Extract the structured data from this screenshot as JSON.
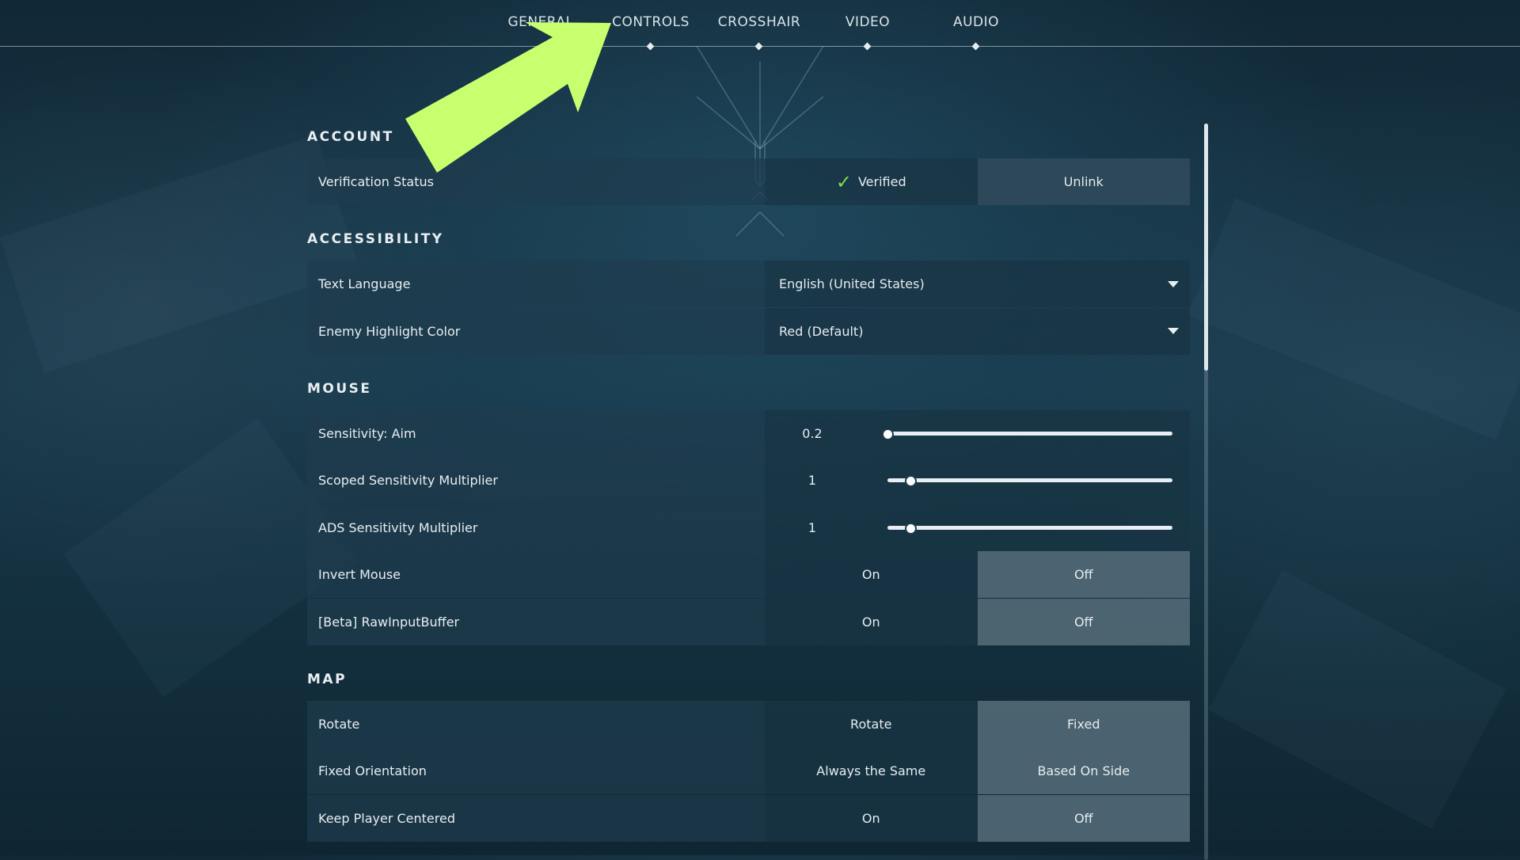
{
  "nav": {
    "tabs": [
      {
        "label": "GENERAL"
      },
      {
        "label": "CONTROLS"
      },
      {
        "label": "CROSSHAIR"
      },
      {
        "label": "VIDEO"
      },
      {
        "label": "AUDIO"
      }
    ]
  },
  "overlay": {
    "arrow_color": "#c8ff6e",
    "arrow_icon": "arrow-up-right"
  },
  "account": {
    "title": "ACCOUNT",
    "verification_label": "Verification Status",
    "verified_label": "Verified",
    "unlink_label": "Unlink"
  },
  "accessibility": {
    "title": "ACCESSIBILITY",
    "language_label": "Text Language",
    "language_value": "English (United States)",
    "highlight_label": "Enemy Highlight Color",
    "highlight_value": "Red (Default)"
  },
  "mouse": {
    "title": "MOUSE",
    "aim_label": "Sensitivity: Aim",
    "aim_value": "0.2",
    "aim_fraction": 0.0,
    "scoped_label": "Scoped Sensitivity Multiplier",
    "scoped_value": "1",
    "scoped_fraction": 0.08,
    "ads_label": "ADS Sensitivity Multiplier",
    "ads_value": "1",
    "ads_fraction": 0.08,
    "invert_label": "Invert Mouse",
    "invert_on": "On",
    "invert_off": "Off",
    "raw_label": "[Beta] RawInputBuffer",
    "raw_on": "On",
    "raw_off": "Off"
  },
  "map": {
    "title": "MAP",
    "rotate_label": "Rotate",
    "rotate_opt": "Rotate",
    "fixed_opt": "Fixed",
    "orientation_label": "Fixed Orientation",
    "always_same": "Always the Same",
    "based_on_side": "Based On Side",
    "centered_label": "Keep Player Centered",
    "centered_on": "On",
    "centered_off": "Off"
  },
  "scroll": {
    "position_fraction": 0.0
  }
}
